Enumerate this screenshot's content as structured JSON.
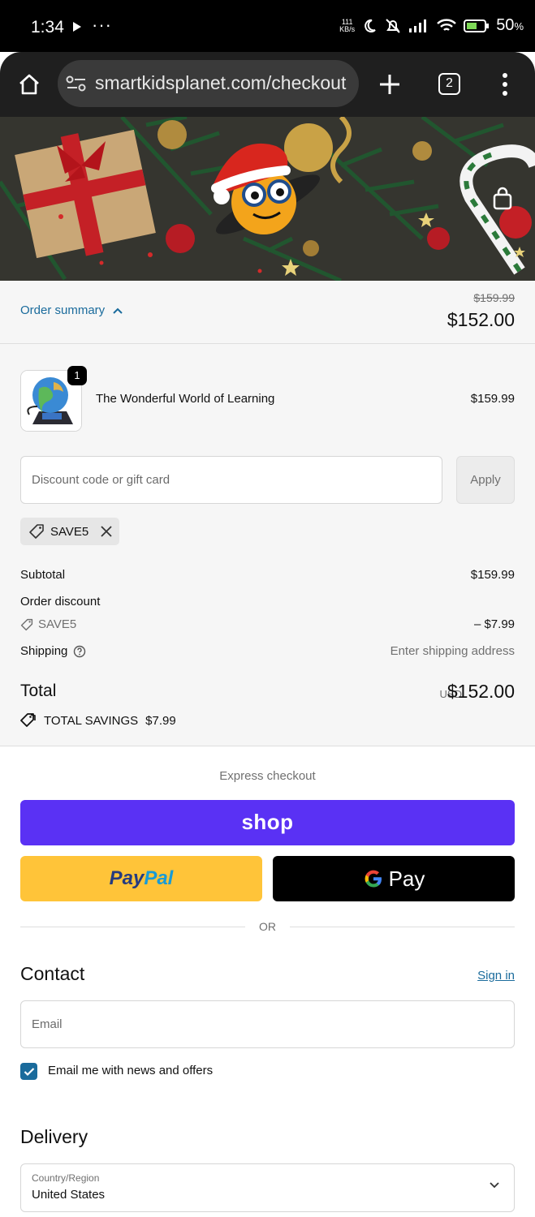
{
  "status_bar": {
    "time": "1:34",
    "more": "···",
    "net_speed_top": "111",
    "net_speed_bottom": "KB/s",
    "battery": "50",
    "battery_unit": "%"
  },
  "browser": {
    "url": "smartkidsplanet.com/checkout",
    "tab_count": "2"
  },
  "order_summary": {
    "toggle_label": "Order summary",
    "original_total": "$159.99",
    "total": "$152.00"
  },
  "product": {
    "quantity": "1",
    "name": "The Wonderful World of Learning",
    "price": "$159.99"
  },
  "discount": {
    "placeholder": "Discount code or gift card",
    "apply_label": "Apply",
    "applied_code": "SAVE5"
  },
  "totals": {
    "subtotal_label": "Subtotal",
    "subtotal_value": "$159.99",
    "order_discount_label": "Order discount",
    "discount_code": "SAVE5",
    "discount_value": "– $7.99",
    "shipping_label": "Shipping",
    "shipping_value": "Enter shipping address",
    "total_label": "Total",
    "currency": "USD",
    "total_value": "$152.00",
    "savings_label": "TOTAL SAVINGS",
    "savings_value": "$7.99"
  },
  "express": {
    "label": "Express checkout",
    "shop_label": "shop",
    "paypal_a": "Pay",
    "paypal_b": "Pal",
    "gpay_label": "Pay",
    "or_label": "OR"
  },
  "contact": {
    "title": "Contact",
    "signin_label": "Sign in",
    "email_placeholder": "Email",
    "newsletter_label": "Email me with news and offers",
    "newsletter_checked": true
  },
  "delivery": {
    "title": "Delivery",
    "country_label": "Country/Region",
    "country_value": "United States"
  },
  "colors": {
    "accent": "#1a6b9c",
    "shop_pay": "#5a31f4",
    "paypal": "#ffc439",
    "gpay": "#000000"
  },
  "icons": [
    "home-icon",
    "tune-icon",
    "add-icon",
    "tabs-icon",
    "more-vert-icon",
    "cart-icon",
    "chevron-up-icon",
    "tag-icon",
    "close-icon",
    "help-icon",
    "savings-tag-icon",
    "google-g-icon",
    "check-icon",
    "chevron-down-icon"
  ]
}
